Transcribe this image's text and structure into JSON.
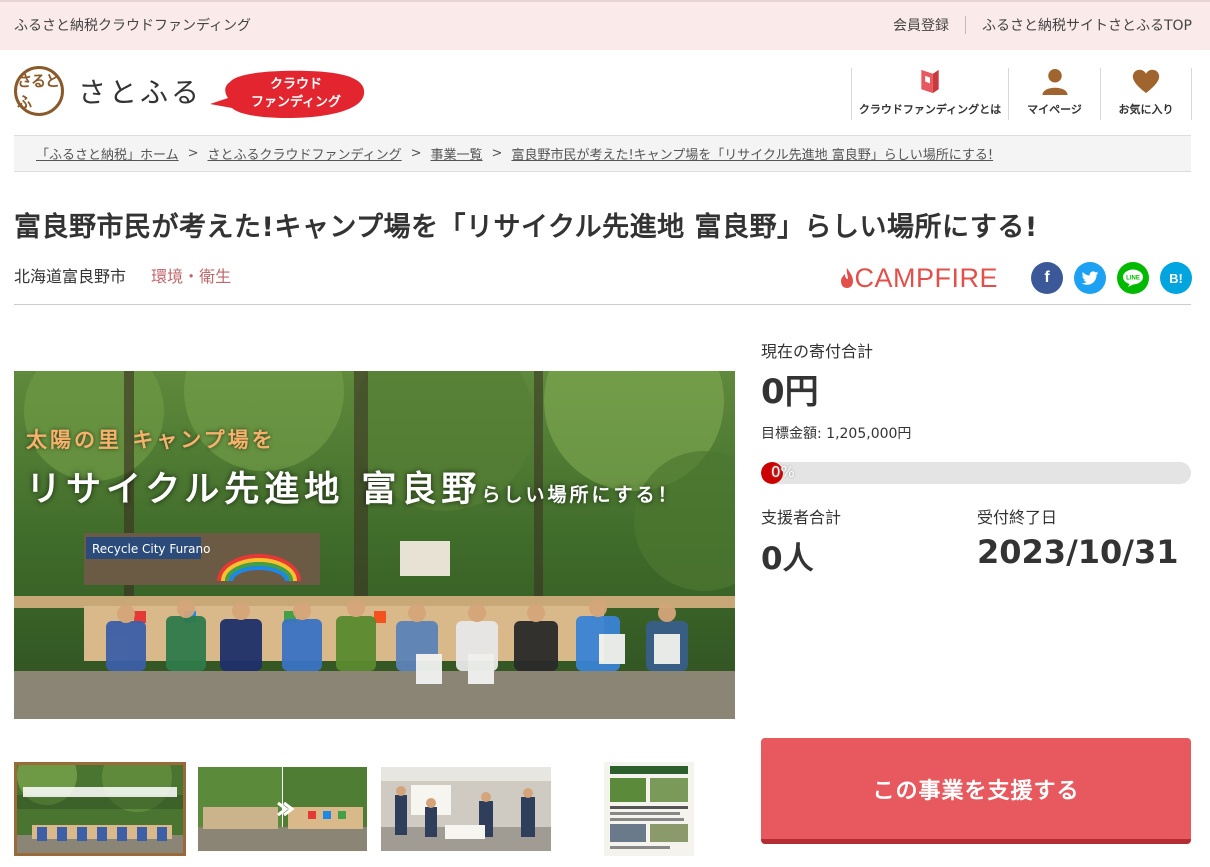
{
  "topbar": {
    "site_title": "ふるさと納税クラウドファンディング",
    "register": "会員登録",
    "top_link": "ふるさと納税サイトさとふるTOP"
  },
  "header": {
    "logo_seal": "さるとふ",
    "logo_text": "さとふる",
    "badge_line1": "クラウド",
    "badge_line2": "ファンディング",
    "nav": [
      {
        "label": "クラウドファンディングとは",
        "icon": "book-icon"
      },
      {
        "label": "マイページ",
        "icon": "user-icon"
      },
      {
        "label": "お気に入り",
        "icon": "heart-icon"
      }
    ]
  },
  "breadcrumb": [
    "「ふるさと納税」ホーム",
    "さとふるクラウドファンディング",
    "事業一覧",
    "富良野市民が考えた!キャンプ場を「リサイクル先進地 富良野」らしい場所にする!"
  ],
  "breadcrumb_separator": ">",
  "project": {
    "title": "富良野市民が考えた!キャンプ場を「リサイクル先進地 富良野」らしい場所にする!",
    "location": "北海道富良野市",
    "category": "環境・衛生",
    "partner": "CAMPFIRE",
    "share": [
      {
        "name": "facebook",
        "glyph": "f",
        "color": "#3b5998"
      },
      {
        "name": "twitter",
        "glyph": "t",
        "color": "#1da1f2"
      },
      {
        "name": "line",
        "glyph": "LINE",
        "color": "#00b900"
      },
      {
        "name": "hatena",
        "glyph": "B!",
        "color": "#00a4de"
      }
    ]
  },
  "hero": {
    "line1": "太陽の里 キャンプ場を",
    "line2": "リサイクル先進地 富良野",
    "line2_small": "らしい場所にする！",
    "sign_text": "Recycle City Furano"
  },
  "stats": {
    "total_label": "現在の寄付合計",
    "total_value": "0円",
    "goal_text": "目標金額: 1,205,000円",
    "progress_percent": 0,
    "progress_text": "0%",
    "supporters_label": "支援者合計",
    "supporters_value": "0人",
    "deadline_label": "受付終了日",
    "deadline_value": "2023/10/31"
  },
  "support_button": "この事業を支援する",
  "colors": {
    "accent": "#e8595f",
    "topbar_bg": "#fbeaea",
    "category": "#c0666b",
    "campfire": "#e3504b"
  }
}
